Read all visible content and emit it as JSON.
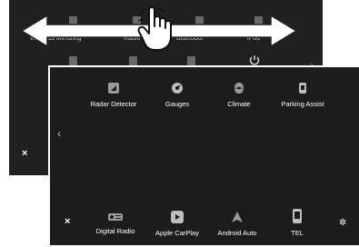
{
  "back_screen": {
    "labels": [
      "Wireless Mirroring",
      "Radio",
      "Bluetooth",
      "iPod"
    ],
    "close_icon": "×",
    "chevron": "›"
  },
  "front_screen": {
    "apps_top": [
      {
        "label": "Radar Detector",
        "icon": "radar-detector-icon"
      },
      {
        "label": "Gauges",
        "icon": "gauges-icon"
      },
      {
        "label": "Climate",
        "icon": "climate-icon"
      },
      {
        "label": "Parking Assist",
        "icon": "parking-assist-icon"
      }
    ],
    "apps_bottom": [
      {
        "label": "Digital Radio",
        "icon": "digital-radio-icon"
      },
      {
        "label": "Apple CarPlay",
        "icon": "apple-carplay-icon"
      },
      {
        "label": "Android Auto",
        "icon": "android-auto-icon"
      },
      {
        "label": "TEL",
        "icon": "tel-icon"
      }
    ],
    "prev_chevron": "‹",
    "close_icon": "×",
    "settings_icon": "✲"
  }
}
